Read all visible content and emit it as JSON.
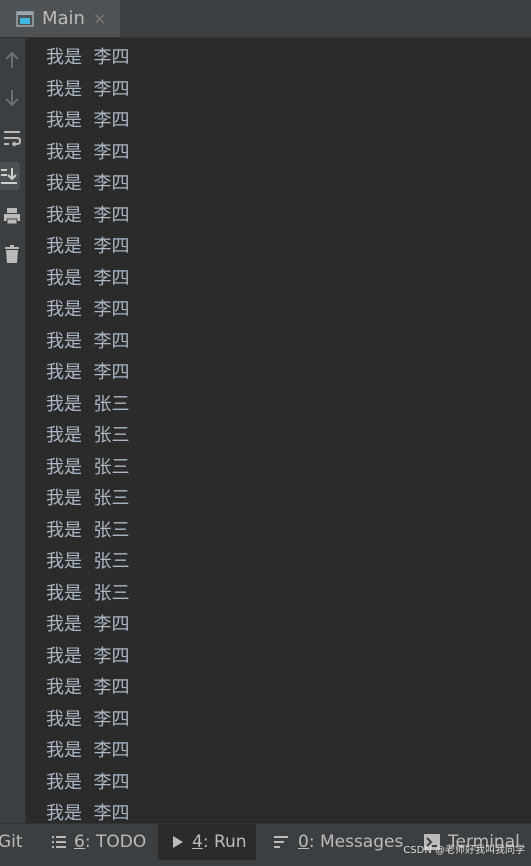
{
  "tab": {
    "title": "Main",
    "close": "×"
  },
  "sidebar": {
    "buttons": [
      "up-arrow-icon",
      "down-arrow-icon",
      "soft-wrap-icon",
      "scroll-to-end-icon",
      "print-icon",
      "trash-icon"
    ]
  },
  "console": {
    "lines": [
      "我是  李四",
      "我是  李四",
      "我是  李四",
      "我是  李四",
      "我是  李四",
      "我是  李四",
      "我是  李四",
      "我是  李四",
      "我是  李四",
      "我是  李四",
      "我是  李四",
      "我是  张三",
      "我是  张三",
      "我是  张三",
      "我是  张三",
      "我是  张三",
      "我是  张三",
      "我是  张三",
      "我是  李四",
      "我是  李四",
      "我是  李四",
      "我是  李四",
      "我是  李四",
      "我是  李四",
      "我是  李四"
    ]
  },
  "bottombar": {
    "git": "Git",
    "todo_num": "6",
    "todo_label": ": TODO",
    "run_num": "4",
    "run_label": ": Run",
    "messages_num": "0",
    "messages_label": ": Messages",
    "terminal": "Terminal"
  },
  "watermark": "CSDN @老师好我叫我同学"
}
